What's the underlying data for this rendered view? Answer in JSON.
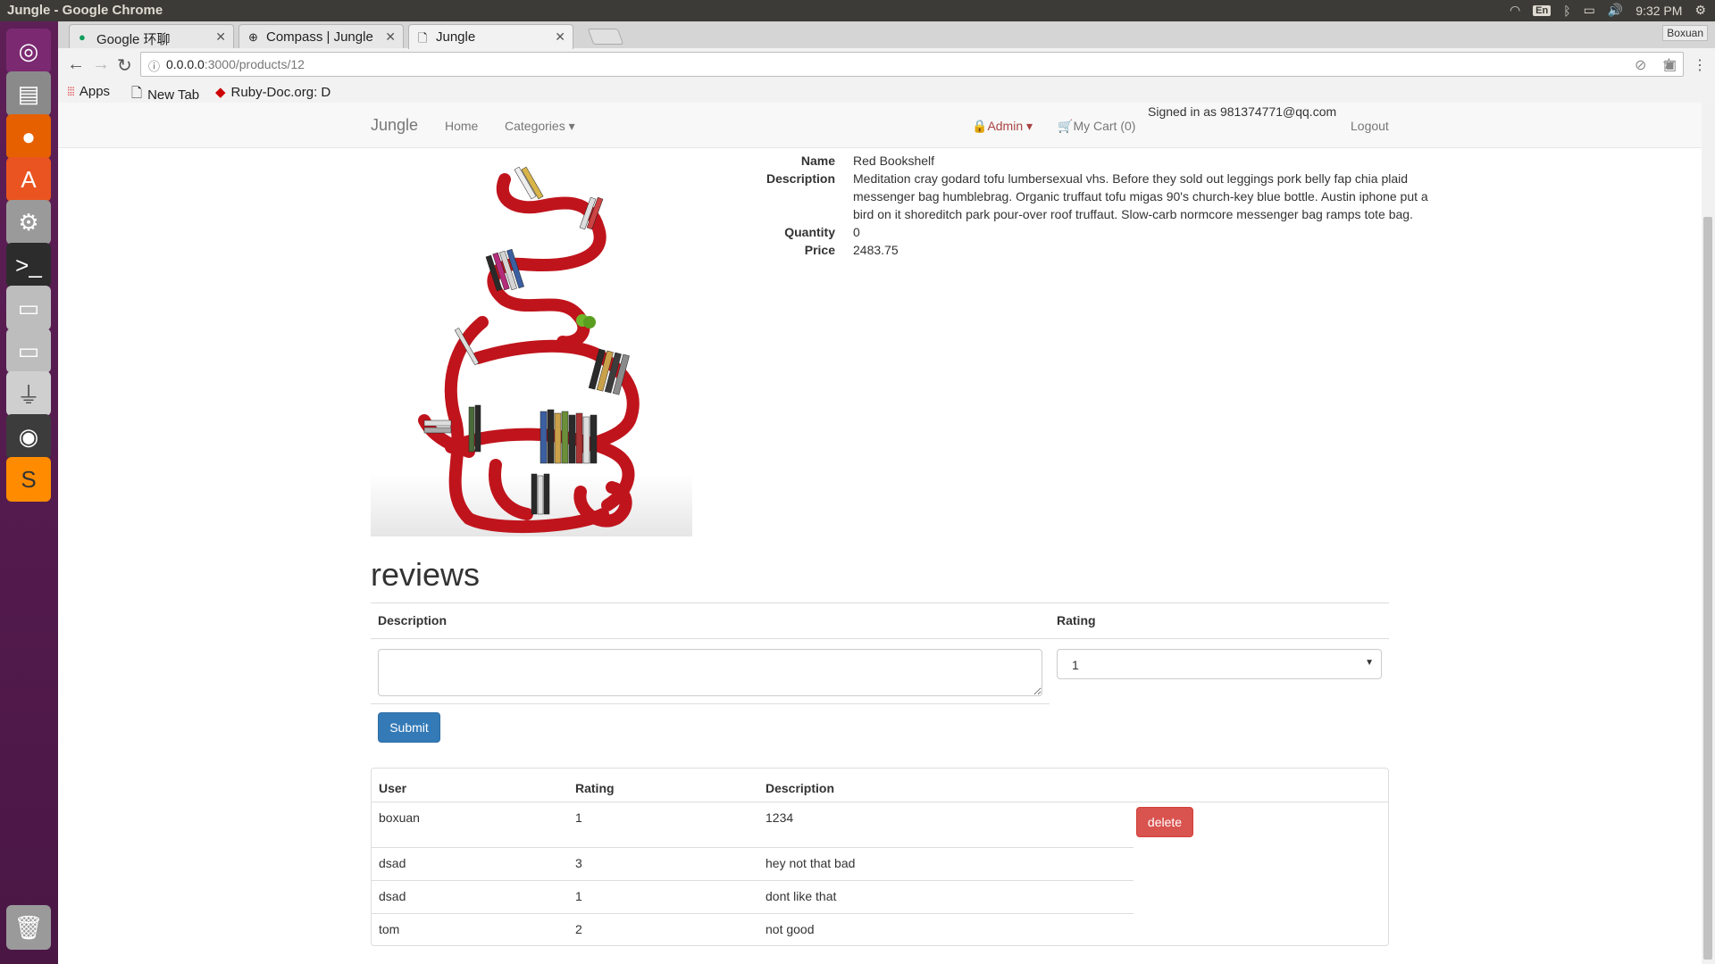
{
  "os": {
    "window_title": "Jungle - Google Chrome",
    "keyboard_layout": "En",
    "clock": "9:32 PM"
  },
  "browser": {
    "tabs": [
      {
        "label": "Google 环聊",
        "favicon": "hangouts-icon"
      },
      {
        "label": "Compass | Jungle",
        "favicon": "compass-icon"
      },
      {
        "label": "Jungle",
        "favicon": "page-icon",
        "active": true
      }
    ],
    "profile_name": "Boxuan",
    "url_host": "0.0.0.0",
    "url_path": ":3000/products/12",
    "bookmarks": [
      {
        "label": "Apps",
        "icon": "apps-grid-icon"
      },
      {
        "label": "New Tab",
        "icon": "page-icon"
      },
      {
        "label": "Ruby-Doc.org: D",
        "icon": "ruby-icon"
      }
    ]
  },
  "navbar": {
    "brand": "Jungle",
    "home": "Home",
    "categories": "Categories",
    "admin": "Admin",
    "cart": "My Cart (0)",
    "signed_in": "Signed in as 981374771@qq.com",
    "logout": "Logout"
  },
  "product": {
    "name_label": "Name",
    "name": "Red Bookshelf",
    "description_label": "Description",
    "description": "Meditation cray godard tofu lumbersexual vhs. Before they sold out leggings pork belly fap chia plaid messenger bag humblebrag. Organic truffaut tofu migas 90's church-key blue bottle. Austin iphone put a bird on it shoreditch park pour-over roof truffaut. Slow-carb normcore messenger bag ramps tote bag.",
    "quantity_label": "Quantity",
    "quantity": "0",
    "price_label": "Price",
    "price": "2483.75"
  },
  "reviews": {
    "heading": "reviews",
    "form": {
      "description_header": "Description",
      "rating_header": "Rating",
      "description_value": "",
      "rating_selected": "1",
      "submit_label": "Submit"
    },
    "table": {
      "headers": [
        "User",
        "Rating",
        "Description"
      ],
      "rows": [
        {
          "user": "boxuan",
          "rating": "1",
          "description": "1234",
          "action": "delete"
        },
        {
          "user": "dsad",
          "rating": "3",
          "description": "hey not that bad"
        },
        {
          "user": "dsad",
          "rating": "1",
          "description": "dont like that"
        },
        {
          "user": "tom",
          "rating": "2",
          "description": "not good"
        }
      ]
    }
  },
  "colors": {
    "primary_button": "#337ab7",
    "danger_button": "#d9534f",
    "launcher": "#5e1f57",
    "bookshelf_red": "#c0141c"
  }
}
